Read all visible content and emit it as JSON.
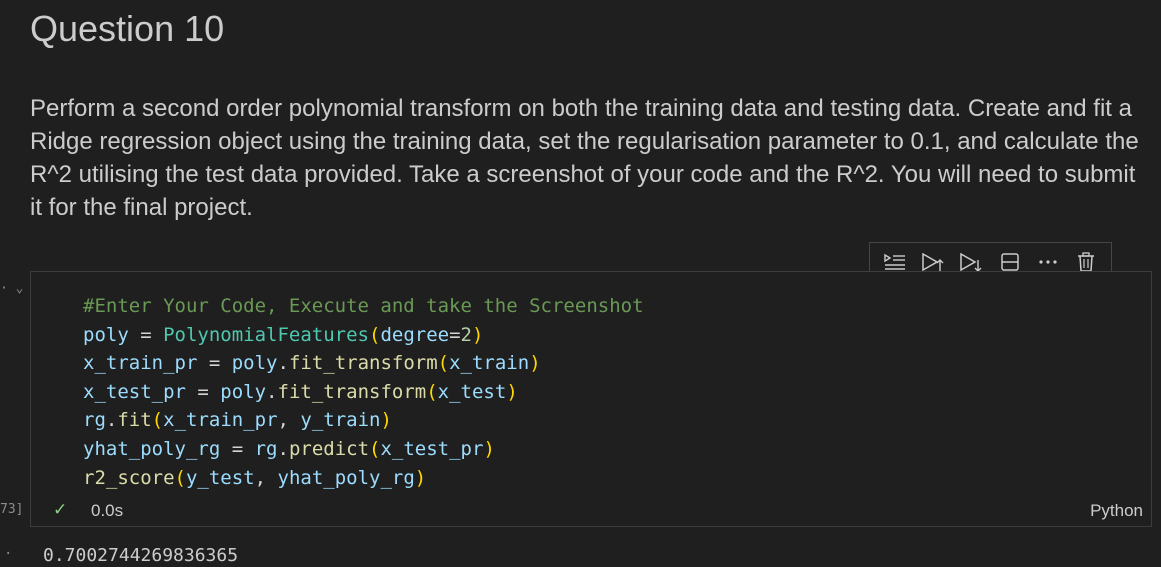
{
  "heading": "Question 10",
  "description": "Perform a second order polynomial transform on both the training data and testing data. Create and fit a Ridge regression object using the training data, set the regularisation parameter to 0.1, and calculate the R^2 utilising the test data provided. Take a screenshot of your code and the R^2. You will need to submit it for the final project.",
  "toolbar": {
    "icons": [
      "execute-above-icon",
      "run-above-icon",
      "run-below-icon",
      "split-cell-icon",
      "more-icon",
      "delete-icon"
    ]
  },
  "cell": {
    "exec_count": "73]",
    "collapse_marker": "· ⌄",
    "code": {
      "l1": "#Enter Your Code, Execute and take the Screenshot",
      "poly": "poly",
      "eq": " = ",
      "PolynomialFeatures": "PolynomialFeatures",
      "degree": "degree",
      "two": "2",
      "x_train_pr": "x_train_pr",
      "fit_transform": "fit_transform",
      "x_train": "x_train",
      "x_test_pr": "x_test_pr",
      "x_test": "x_test",
      "rg": "rg",
      "fit": "fit",
      "y_train": "y_train",
      "yhat_poly_rg": "yhat_poly_rg",
      "predict": "predict",
      "r2_score": "r2_score",
      "y_test": "y_test"
    },
    "status_check": "✓",
    "duration": "0.0s",
    "language": "Python"
  },
  "output": {
    "marker": "·",
    "value": "0.7002744269836365"
  },
  "colors": {
    "background": "#1f1f1f",
    "comment": "#6a9955",
    "variable": "#9cdcfe",
    "class": "#4ec9b0",
    "function": "#dcdcaa",
    "number": "#b5cea8",
    "success": "#89d185"
  }
}
